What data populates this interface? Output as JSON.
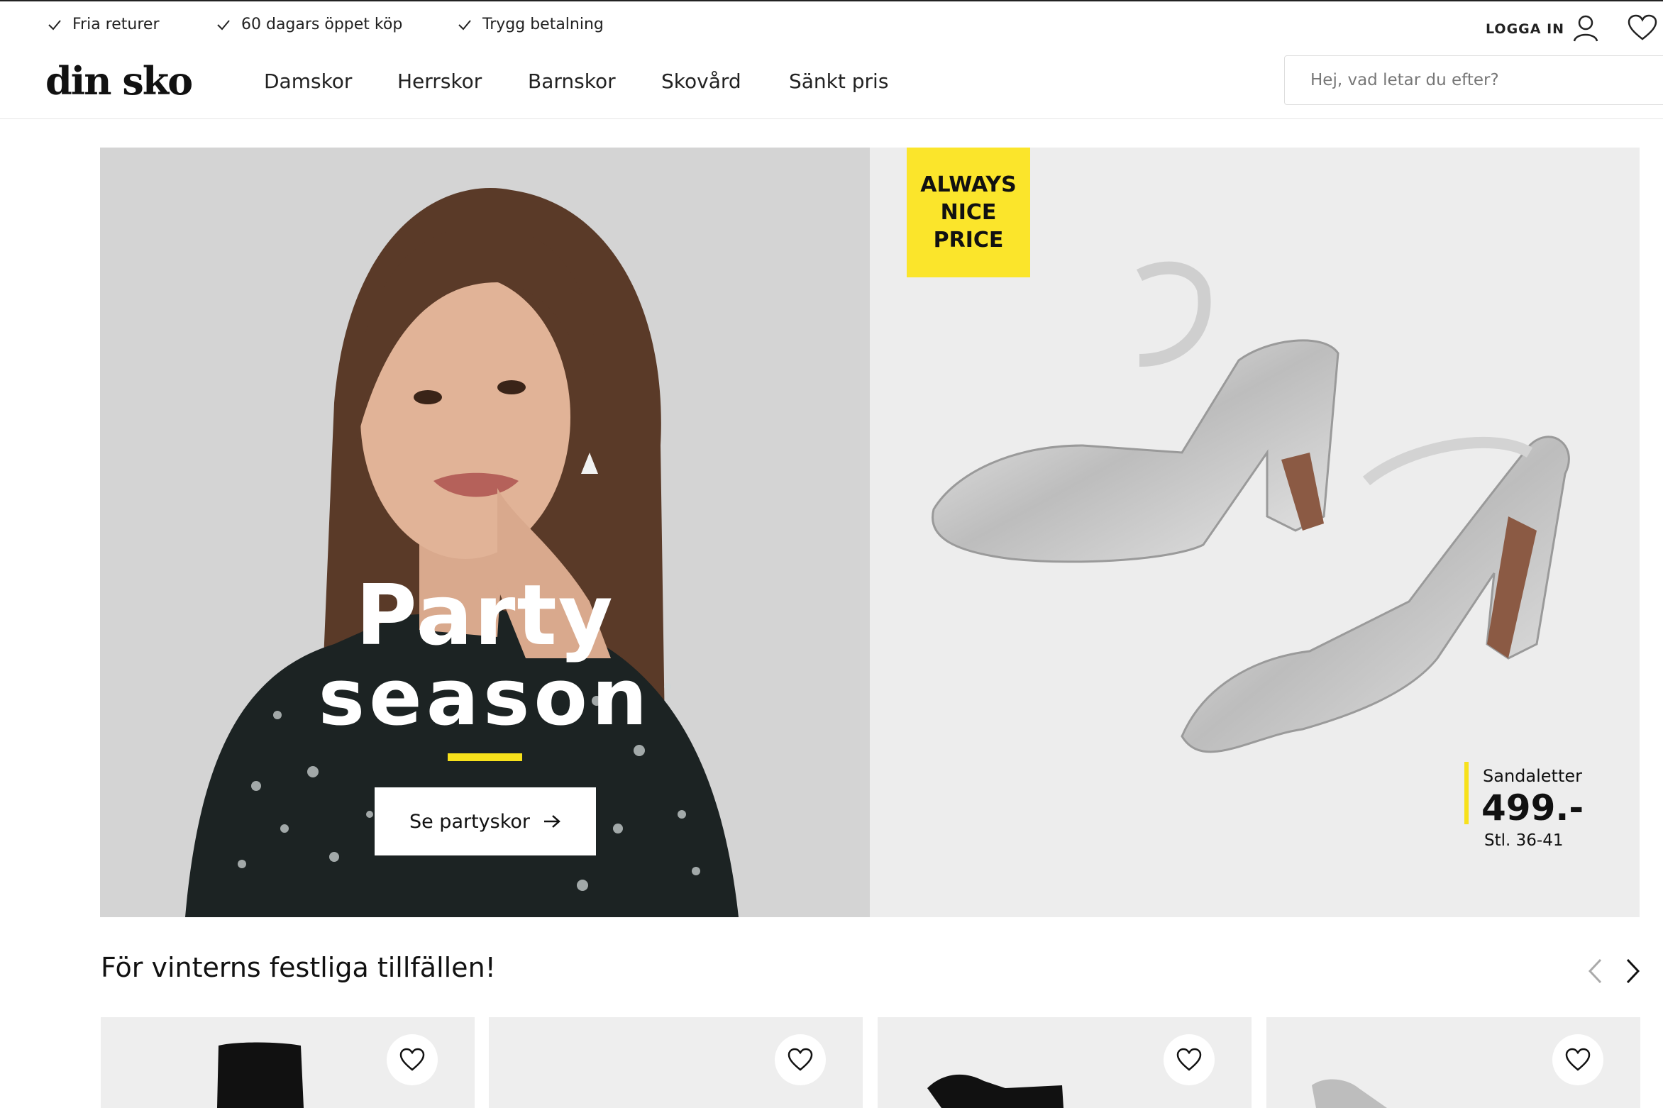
{
  "usp": [
    {
      "label": "Fria returer"
    },
    {
      "label": "60 dagars öppet köp"
    },
    {
      "label": "Trygg betalning"
    }
  ],
  "account": {
    "login_label": "LOGGA IN"
  },
  "header": {
    "logo": "din sko",
    "nav": [
      "Damskor",
      "Herrskor",
      "Barnskor",
      "Skovård",
      "Sänkt pris"
    ],
    "search_placeholder": "Hej, vad letar du efter?"
  },
  "hero": {
    "title_line1": "Party",
    "title_line2": "season",
    "cta_label": "Se partyskor",
    "badge": [
      "ALWAYS",
      "NICE",
      "PRICE"
    ],
    "product_name": "Sandaletter",
    "product_price": "499.-",
    "product_sizes": "Stl. 36-41"
  },
  "section": {
    "title": "För vinterns festliga tillfällen!"
  },
  "colors": {
    "accent_yellow": "#f7e11b",
    "text": "#1a1a1a",
    "hero_left_bg": "#d4d4d4",
    "hero_right_bg": "#ededed"
  }
}
